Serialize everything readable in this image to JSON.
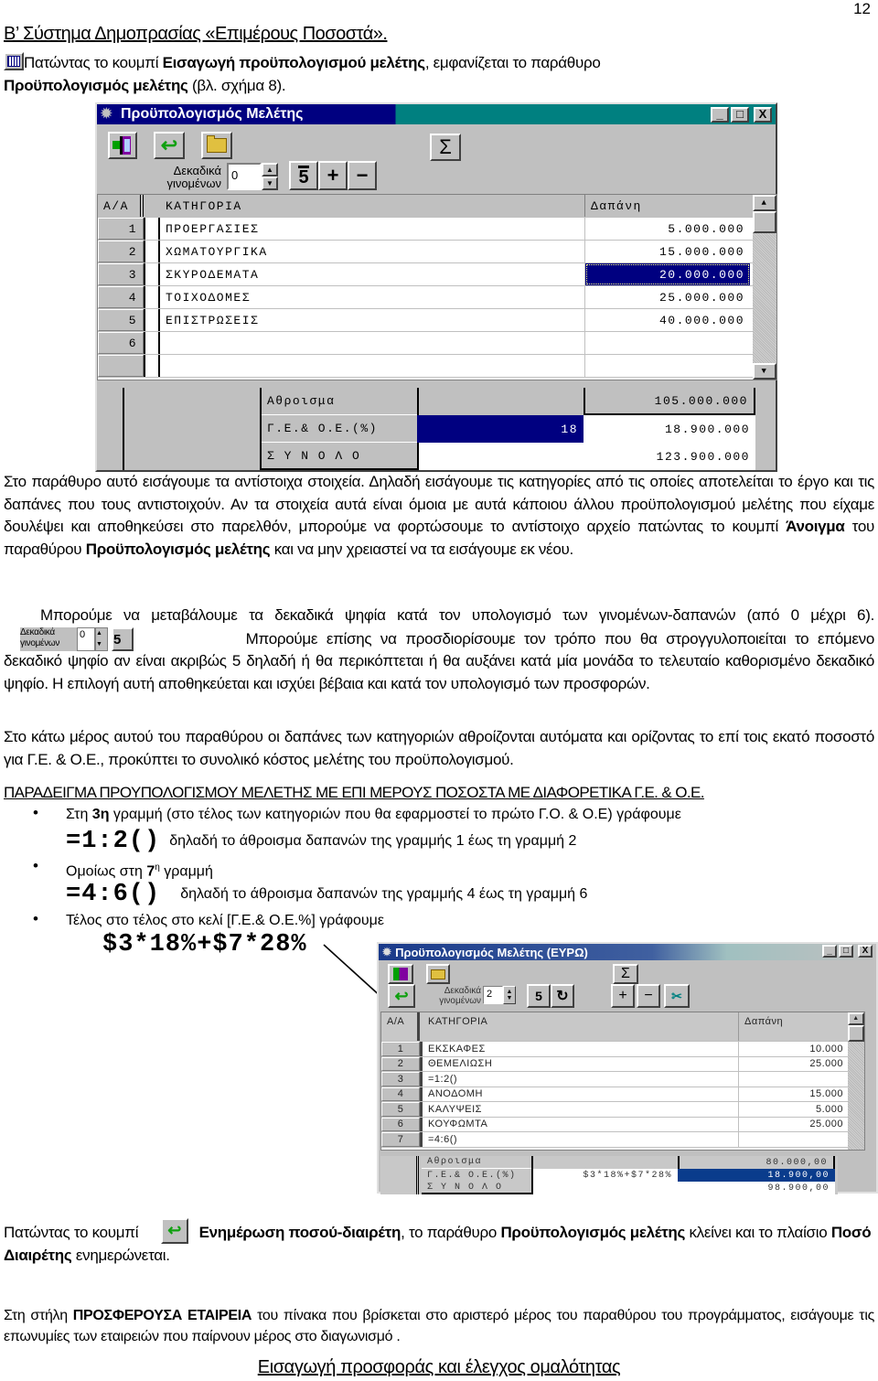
{
  "page_number": "12",
  "heading": "Β’ Σύστημα Δημοπρασίας «Επιμέρους Ποσοστά».",
  "intro": {
    "icon": "table-icon",
    "t1": "Πατώντας το κουμπί ",
    "b1": "Εισαγωγή προϋπολογισμού μελέτης",
    "t2": ", εμφανίζεται το παράθυρο ",
    "b2": "Προϋπολογισμός μελέτης",
    "t3": " (βλ. σχήμα 8)."
  },
  "window1": {
    "title": "Προϋπολογισμός Μελέτης",
    "controls": {
      "minimize": "_",
      "maximize": "□",
      "close": "X"
    },
    "toolbar": {
      "buttons": [
        "exit-icon",
        "update-icon",
        "open-folder-icon",
        "sum-icon",
        "rounding-icon",
        "add-row-icon",
        "remove-row-icon"
      ],
      "sum_label": "Σ",
      "rounding_label": "5",
      "add_label": "+",
      "remove_label": "−",
      "decimals_label_1": "Δεκαδικά",
      "decimals_label_2": "γινομένων",
      "decimals_value": "0"
    },
    "columns": [
      "Α/Α",
      "ΚΑΤΗΓΟΡΙΑ",
      "Δαπάνη"
    ],
    "rows": [
      {
        "n": "1",
        "category": "ΠΡΟΕΡΓΑΣΙΕΣ",
        "cost": "5.000.000"
      },
      {
        "n": "2",
        "category": "ΧΩΜΑΤΟΥΡΓΙΚΑ",
        "cost": "15.000.000"
      },
      {
        "n": "3",
        "category": "ΣΚΥΡΟΔΕΜΑΤΑ",
        "cost": "20.000.000"
      },
      {
        "n": "4",
        "category": "ΤΟΙΧΟΔΟΜΕΣ",
        "cost": "25.000.000"
      },
      {
        "n": "5",
        "category": "ΕΠΙΣΤΡΩΣΕΙΣ",
        "cost": "40.000.000"
      },
      {
        "n": "6",
        "category": "",
        "cost": ""
      },
      {
        "n": "",
        "category": "",
        "cost": ""
      }
    ],
    "totals": {
      "sum_label": "Αθροισμα",
      "sum_value": "105.000.000",
      "ge_label": "Γ.Ε.& Ο.Ε.(%)",
      "ge_percent": "18",
      "ge_value": "18.900.000",
      "total_label": "Σ Υ Ν Ο Λ Ο",
      "total_value": "123.900.000"
    }
  },
  "para1": {
    "t1": "Στο παράθυρο αυτό εισάγουμε τα αντίστοιχα στοιχεία. Δηλαδή εισάγουμε τις κατηγορίες από τις οποίες αποτελείται το έργο και τις δαπάνες  που τους αντιστοιχούν. Αν τα στοιχεία αυτά είναι όμοια με αυτά κάποιου άλλου προϋπολογισμού μελέτης που είχαμε δουλέψει και αποθηκεύσει στο παρελθόν, μπορούμε να φορτώσουμε το αντίστοιχο αρχείο πατώντας το κουμπί ",
    "b1": "Άνοιγμα",
    "t2": " του παραθύρου ",
    "b2": "Προϋπολογισμός μελέτης",
    "t3": " και να μην χρειαστεί να τα εισάγουμε εκ νέου."
  },
  "para2": {
    "t1": "Μπορούμε να μεταβάλουμε τα δεκαδικά ψηφία κατά τον υπολογισμό των γινομένων-δαπανών (από 0 μέχρι 6).",
    "inline_label_1": "Δεκαδικά",
    "inline_label_2": "γινομένων",
    "inline_value": "0",
    "inline_round": "5",
    "t2": "Μπορούμε επίσης να προσδιορίσουμε τον τρόπο που θα στρογγυλοποιείται  το επόμενο δεκαδικό ψηφίο αν είναι ακριβώς 5  δηλαδή ή θα περικόπτεται ή θα αυξάνει κατά μία μονάδα το τελευταίο  καθορισμένο δεκαδικό ψηφίο. Η επιλογή αυτή αποθηκεύεται και ισχύει βέβαια και κατά τον υπολογισμό των προσφορών."
  },
  "para3": "Στο κάτω μέρος αυτού του παραθύρου οι δαπάνες των κατηγοριών αθροίζονται αυτόματα και ορίζοντας το επί τοις εκατό ποσοστό για Γ.Ε. & Ο.Ε., προκύπτει το συνολικό κόστος μελέτης του προϋπολογισμού.",
  "example_heading": "ΠΑΡΑΔΕΙΓΜΑ ΠΡΟΥΠΟΛΟΓΙΣΜΟΥ ΜΕΛΕΤΗΣ ΜΕ ΕΠΙ ΜΕΡΟΥΣ ΠΟΣΟΣΤΑ ΜΕ ΔΙΑΦΟΡΕΤΙΚΑ Γ.Ε. & Ο.Ε.",
  "bullets": [
    {
      "pre": "Στη ",
      "bold": "3η",
      "post": " γραμμή (στο τέλος των κατηγοριών που θα εφαρμοστεί το πρώτο Γ.Ο. & Ο.Ε) γράφουμε"
    },
    {
      "pre": "Ομοίως στη ",
      "bold": "7",
      "sup": "η",
      "post": "  γραμμή"
    },
    {
      "pre": "Τέλος στο τέλος στο κελί  [Γ.Ε.& Ο.Ε.%] γράφουμε",
      "bold": "",
      "post": ""
    }
  ],
  "formula1": {
    "code": "=1:2()",
    "desc": "δηλαδή το άθροισμα δαπανών της γραμμής 1 έως τη γραμμή 2"
  },
  "formula2": {
    "code": "=4:6()",
    "desc": "δηλαδή το άθροισμα δαπανών της γραμμής 4 έως τη γραμμή 6"
  },
  "formula3": "$3*18%+$7*28%",
  "window2": {
    "title": "Προϋπολογισμός Μελέτης (ΕΥΡΩ)",
    "controls": {
      "minimize": "_",
      "maximize": "□",
      "close": "X"
    },
    "toolbar": {
      "decimals_label_1": "Δεκαδικά",
      "decimals_label_2": "γινομένων",
      "decimals_value": "2",
      "sum_label": "Σ",
      "rounding_label": "5",
      "add_label": "+",
      "remove_label": "−"
    },
    "columns": [
      "Α/Α",
      "ΚΑΤΗΓΟΡΙΑ",
      "Δαπάνη"
    ],
    "rows": [
      {
        "n": "1",
        "category": "ΕΚΣΚΑΦΕΣ",
        "cost": "10.000"
      },
      {
        "n": "2",
        "category": "ΘΕΜΕΛΙΩΣΗ",
        "cost": "25.000"
      },
      {
        "n": "3",
        "category": "=1:2()",
        "cost": ""
      },
      {
        "n": "4",
        "category": "ΑΝΟΔΟΜΗ",
        "cost": "15.000"
      },
      {
        "n": "5",
        "category": "ΚΑΛΥΨΕΙΣ",
        "cost": "5.000"
      },
      {
        "n": "6",
        "category": "ΚΟΥΦΩΜΤΑ",
        "cost": "25.000"
      },
      {
        "n": "7",
        "category": "=4:6()",
        "cost": ""
      }
    ],
    "totals": {
      "sum_label": "Αθροισμα",
      "sum_value": "80.000,00",
      "ge_label": "Γ.Ε.& Ο.Ε.(%)",
      "ge_formula": "$3*18%+$7*28%",
      "ge_value": "18.900,00",
      "total_label": "Σ Υ Ν Ο Λ Ο",
      "total_value": "98.900,00"
    }
  },
  "para4": {
    "t1": "Πατώντας το κουμπί ",
    "b1": "Ενημέρωση ποσού-διαιρέτη",
    "t2": ", το παράθυρο ",
    "b2": "Προϋπολογισμός μελέτης",
    "t3": " κλείνει και το πλαίσιο ",
    "b3": "Ποσό Διαιρέτης",
    "t4": " ενημερώνεται."
  },
  "para5": {
    "t1": "Στη στήλη ",
    "b1": "ΠΡΟΣΦΕΡΟΥΣΑ ΕΤΑΙΡΕΙΑ",
    "t2": " του πίνακα που βρίσκεται στο αριστερό μέρος του παραθύρου του προγράμματος, εισάγουμε τις επωνυμίες των εταιρειών που παίρνουν μέρος στο διαγωνισμό ."
  },
  "section_heading": "Εισαγωγή προσφοράς και έλεγχος ομαλότητας"
}
